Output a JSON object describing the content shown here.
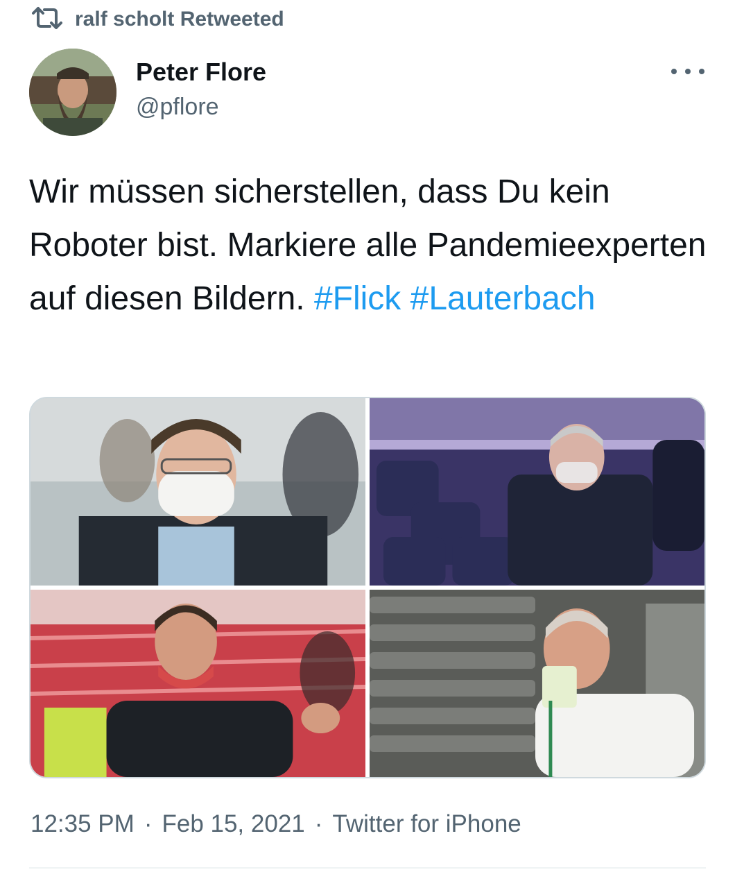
{
  "retweet": {
    "icon": "retweet-icon",
    "label": "ralf scholt Retweeted"
  },
  "author": {
    "name": "Peter Flore",
    "handle": "@pflore",
    "avatar_icon": "avatar"
  },
  "more_icon": "more-options-icon",
  "tweet": {
    "text": "Wir müssen sicherstellen, dass Du kein Roboter bist. Markiere alle Pandemieexperten auf diesen Bildern.",
    "hashtags": [
      "#Flick",
      "#Lauterbach"
    ],
    "hashtag_color": "#1d9bf0"
  },
  "media": {
    "count": 4
  },
  "meta": {
    "time": "12:35 PM",
    "sep1": "·",
    "date": "Feb 15, 2021",
    "sep2": "·",
    "source": "Twitter for iPhone"
  },
  "colors": {
    "text": "#0f1419",
    "secondary": "#536471",
    "accent": "#1d9bf0"
  }
}
